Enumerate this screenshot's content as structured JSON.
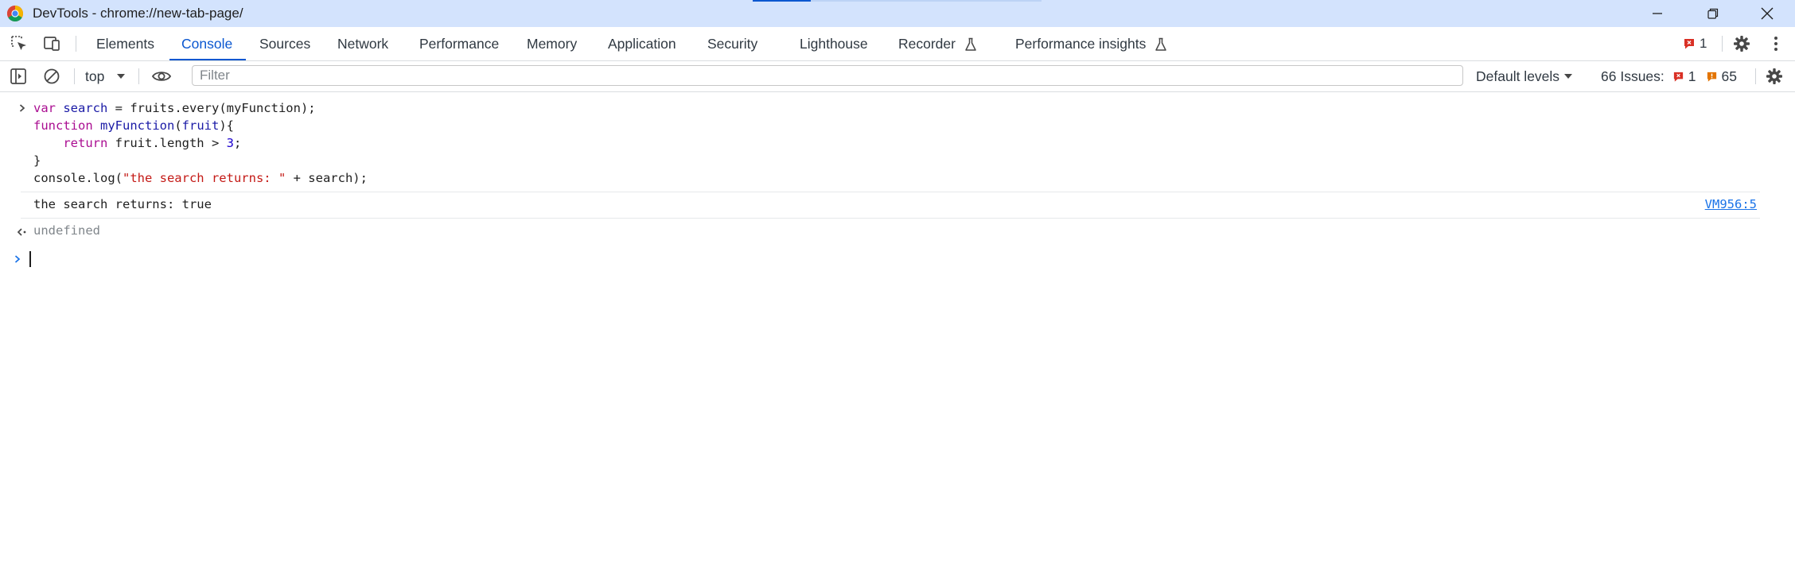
{
  "window": {
    "title": "DevTools - chrome://new-tab-page/"
  },
  "toolbar": {
    "tabs": [
      {
        "label": "Elements"
      },
      {
        "label": "Console"
      },
      {
        "label": "Sources"
      },
      {
        "label": "Network"
      },
      {
        "label": "Performance"
      },
      {
        "label": "Memory"
      },
      {
        "label": "Application"
      },
      {
        "label": "Security"
      },
      {
        "label": "Lighthouse"
      },
      {
        "label": "Recorder"
      },
      {
        "label": "Performance insights"
      }
    ],
    "active_tab": "Console",
    "error_count": "1"
  },
  "console_toolbar": {
    "context": "top",
    "filter_placeholder": "Filter",
    "levels": "Default levels",
    "issues_label": "66 Issues:",
    "issues_errors": "1",
    "issues_warnings": "65"
  },
  "console": {
    "input_lines": [
      "var search = fruits.every(myFunction);",
      "function myFunction(fruit){",
      "    return fruit.length > 3;",
      "}",
      "console.log(\"the search returns: \" + search);"
    ],
    "log_message": "the search returns: true",
    "log_source": "VM956:5",
    "result": "undefined"
  },
  "colors": {
    "accent": "#0b57d0",
    "titlebar": "#d3e3fd",
    "error": "#d93025",
    "warning": "#e37400",
    "link": "#1a73e8"
  }
}
